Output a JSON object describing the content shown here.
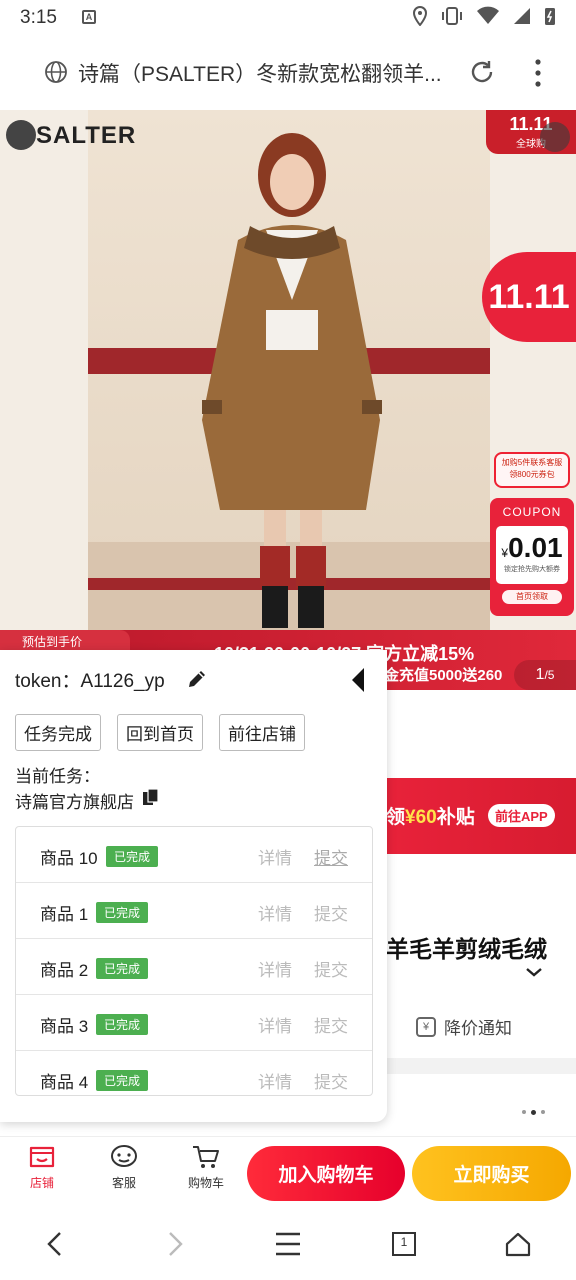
{
  "status": {
    "time": "3:15",
    "sim_label": "A"
  },
  "browser": {
    "page_title": "诗篇（PSALTER）冬新款宽松翻领羊...",
    "tab_count": "1"
  },
  "hero": {
    "brand": "SALTER",
    "corner_badge_top": "11.11",
    "corner_badge_sub": "全球购",
    "float_badge": "11.11",
    "promo_chip_line1": "加购5件联系客服",
    "promo_chip_line2": "领800元券包",
    "coupon_title": "COUPON",
    "coupon_amount": "0.01",
    "coupon_currency": "¥",
    "coupon_sub": "锁定抢先购大额券",
    "coupon_button": "首页领取",
    "price_est": "预估到手价",
    "promo_line1": "10/31 20:00-10/27  官方立减15%",
    "promo_line2": "金充值5000送260",
    "pager_current": "1",
    "pager_total": "/5"
  },
  "content": {
    "subsidy_prefix": "领",
    "subsidy_amount": "¥60",
    "subsidy_suffix": "补贴",
    "subsidy_app": "前往APP",
    "product_name_fragment": "羊毛羊剪绒毛绒",
    "price_alert": "降价通知",
    "price_alert_icon": "¥"
  },
  "panel": {
    "token_label": "token：",
    "token_value": "A1126_yp",
    "buttons": [
      "任务完成",
      "回到首页",
      "前往店铺"
    ],
    "current_task_label": "当前任务：",
    "current_shop": "诗篇官方旗舰店",
    "tasks": [
      {
        "name": "商品 10",
        "status": "已完成",
        "detail": "详情",
        "submit": "提交"
      },
      {
        "name": "商品 1",
        "status": "已完成",
        "detail": "详情",
        "submit": "提交"
      },
      {
        "name": "商品 2",
        "status": "已完成",
        "detail": "详情",
        "submit": "提交"
      },
      {
        "name": "商品 3",
        "status": "已完成",
        "detail": "详情",
        "submit": "提交"
      },
      {
        "name": "商品 4",
        "status": "已完成",
        "detail": "详情",
        "submit": "提交"
      }
    ]
  },
  "actionbar": {
    "store": "店铺",
    "service": "客服",
    "cart": "购物车",
    "add_to_cart": "加入购物车",
    "buy_now": "立即购买"
  },
  "colors": {
    "accent_red": "#e8223a",
    "buy_yellow": "#f5b300",
    "done_green": "#4caf50"
  }
}
